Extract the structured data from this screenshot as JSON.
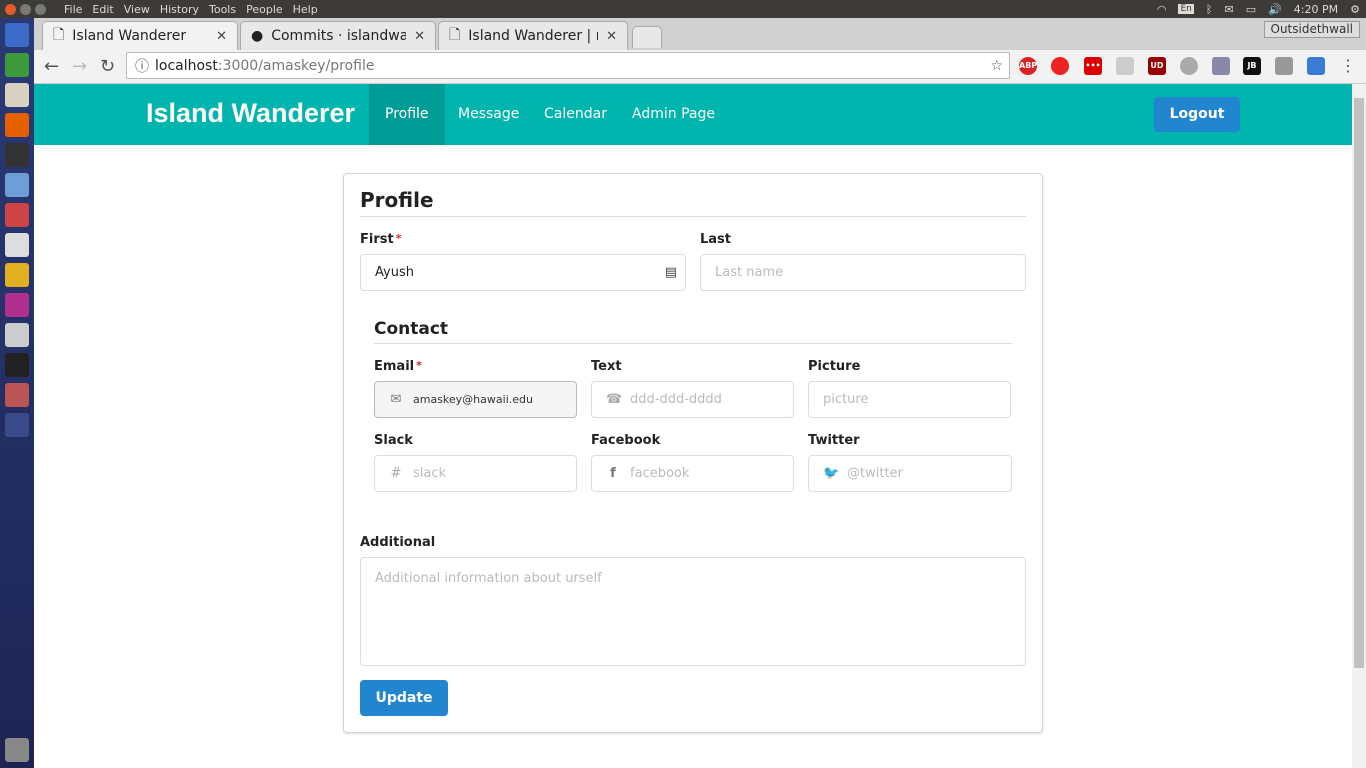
{
  "os": {
    "menu": [
      "File",
      "Edit",
      "View",
      "History",
      "Tools",
      "People",
      "Help"
    ],
    "tray": {
      "lang": "En",
      "time": "4:20 PM"
    }
  },
  "browser": {
    "tabs": [
      {
        "title": "Island Wanderer"
      },
      {
        "title": "Commits · islandwa"
      },
      {
        "title": "Island Wanderer | m"
      }
    ],
    "profile": "Outsidethwall",
    "url_host": "localhost",
    "url_path": ":3000/amaskey/profile",
    "extensions": [
      "ABP",
      "",
      "•••",
      "",
      "UD",
      "",
      "",
      "JB",
      "",
      ""
    ]
  },
  "app": {
    "brand": "Island Wanderer",
    "nav": [
      "Profile",
      "Message",
      "Calendar",
      "Admin Page"
    ],
    "active_nav": "Profile",
    "logout": "Logout"
  },
  "form": {
    "title": "Profile",
    "first_label": "First",
    "first_value": "Ayush",
    "last_label": "Last",
    "last_placeholder": "Last name",
    "contact_title": "Contact",
    "email_label": "Email",
    "email_value": "amaskey@hawaii.edu",
    "text_label": "Text",
    "text_placeholder": "ddd-ddd-dddd",
    "picture_label": "Picture",
    "picture_placeholder": "picture",
    "slack_label": "Slack",
    "slack_placeholder": "slack",
    "facebook_label": "Facebook",
    "facebook_placeholder": "facebook",
    "twitter_label": "Twitter",
    "twitter_placeholder": "@twitter",
    "additional_label": "Additional",
    "additional_placeholder": "Additional information about urself",
    "required_mark": "*",
    "update": "Update"
  },
  "colors": {
    "navbar": "#00b5ad",
    "primary": "#2185d0"
  }
}
